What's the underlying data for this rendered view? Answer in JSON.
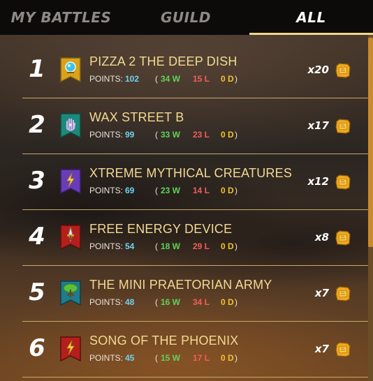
{
  "tabs": [
    {
      "label": "MY BATTLES",
      "active": false
    },
    {
      "label": "GUILD",
      "active": false
    },
    {
      "label": "ALL",
      "active": true
    }
  ],
  "points_label": "POINTS:",
  "guilds": [
    {
      "rank": "1",
      "name": "PIZZA 2 THE DEEP DISH",
      "points": "102",
      "wins": "34 W",
      "losses": "15 L",
      "draws": "0 D",
      "multiplier": "x20",
      "banner_icon": "crystal-orb-icon",
      "banner_color": "#d9a21a"
    },
    {
      "rank": "2",
      "name": "WAX STREET B",
      "points": "99",
      "wins": "33 W",
      "losses": "23 L",
      "draws": "0 D",
      "multiplier": "x17",
      "banner_icon": "hand-icon",
      "banner_color": "#1c8a7a"
    },
    {
      "rank": "3",
      "name": "XTREME MYTHICAL CREATURES",
      "points": "69",
      "wins": "23 W",
      "losses": "14 L",
      "draws": "0 D",
      "multiplier": "x12",
      "banner_icon": "lightning-icon",
      "banner_color": "#6a3cb8"
    },
    {
      "rank": "4",
      "name": "FREE ENERGY DEVICE",
      "points": "54",
      "wins": "18 W",
      "losses": "29 L",
      "draws": "0 D",
      "multiplier": "x8",
      "banner_icon": "dagger-icon",
      "banner_color": "#b3201c"
    },
    {
      "rank": "5",
      "name": "THE MINI PRAETORIAN ARMY",
      "points": "48",
      "wins": "16 W",
      "losses": "34 L",
      "draws": "0 D",
      "multiplier": "x7",
      "banner_icon": "tree-icon",
      "banner_color": "#1e7c8c"
    },
    {
      "rank": "6",
      "name": "SONG OF THE PHOENIX",
      "points": "45",
      "wins": "15 W",
      "losses": "17 L",
      "draws": "0 D",
      "multiplier": "x7",
      "banner_icon": "lightning-icon",
      "banner_color": "#b3201c"
    }
  ],
  "reward_icon": "reward-chest-icon",
  "colors": {
    "accent": "#f0d68e",
    "points": "#6fd3ef",
    "wins": "#5fd35a",
    "losses": "#f05e5e",
    "draws": "#f1c232"
  }
}
